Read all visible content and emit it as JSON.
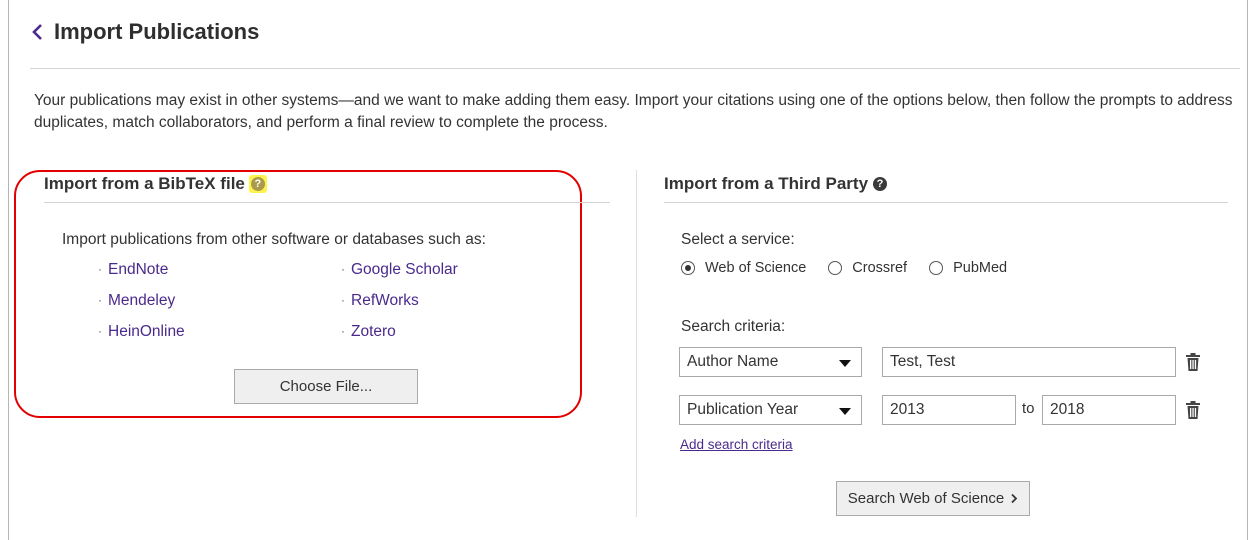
{
  "header": {
    "title": "Import Publications"
  },
  "intro": {
    "text": "Your publications may exist in other systems—and we want to make adding them easy. Import your citations using one of the options below, then follow the prompts to address duplicates, match collaborators, and perform a final review to complete the process."
  },
  "bibtex": {
    "title": "Import from a BibTeX file",
    "description": "Import publications from other software or databases such as:",
    "links_col1": [
      "EndNote",
      "Mendeley",
      "HeinOnline"
    ],
    "links_col2": [
      "Google Scholar",
      "RefWorks",
      "Zotero"
    ],
    "choose_button": "Choose File..."
  },
  "third_party": {
    "title": "Import from a Third Party",
    "service_label": "Select a service:",
    "services": [
      {
        "label": "Web of Science",
        "selected": true
      },
      {
        "label": "Crossref",
        "selected": false
      },
      {
        "label": "PubMed",
        "selected": false
      }
    ],
    "criteria_label": "Search criteria:",
    "criteria_rows": [
      {
        "field": "Author Name",
        "value": "Test, Test"
      },
      {
        "field": "Publication Year",
        "from": "2013",
        "to_label": "to",
        "to": "2018"
      }
    ],
    "add_criteria_link": "Add search criteria",
    "search_button": "Search Web of Science"
  },
  "colors": {
    "link": "#4a2a8c",
    "highlight_outline": "#e20000",
    "help_highlight": "#fff24d"
  },
  "icons": [
    "chevron-left-icon",
    "question-circle-icon",
    "trash-icon",
    "chevron-right-icon"
  ]
}
